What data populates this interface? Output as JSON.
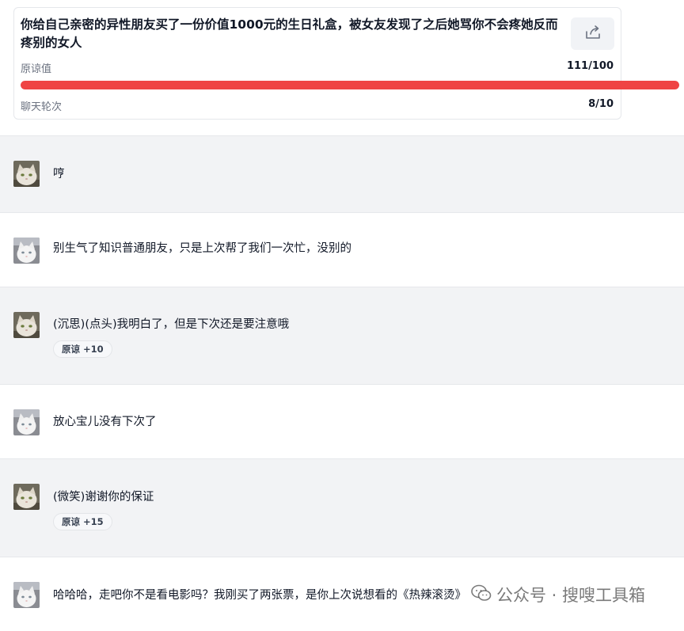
{
  "scenario": {
    "title": "你给自己亲密的异性朋友买了一份价值1000元的生日礼盒，被女友发现了之后她骂你不会疼她反而疼别的女人",
    "share_icon": "share-icon"
  },
  "forgiveness": {
    "label": "原谅值",
    "display": "111/100",
    "fraction": 1.0,
    "bar_color": "#ef4444"
  },
  "rounds": {
    "label": "聊天轮次",
    "display": "8/10"
  },
  "messages": [
    {
      "role": "girlfriend",
      "text": "哼",
      "avatar_icon": "cat-avatar-icon"
    },
    {
      "role": "user",
      "text": "别生气了知识普通朋友，只是上次帮了我们一次忙，没别的",
      "avatar_icon": "white-cat-avatar-icon"
    },
    {
      "role": "girlfriend",
      "text": "(沉思)(点头)我明白了，但是下次还是要注意哦",
      "badge": {
        "label": "原谅",
        "delta": "+10"
      }
    },
    {
      "role": "user",
      "text": "放心宝儿没有下次了"
    },
    {
      "role": "girlfriend",
      "text": "(微笑)谢谢你的保证",
      "badge": {
        "label": "原谅",
        "delta": "+15"
      }
    },
    {
      "role": "user",
      "text": "哈哈哈，走吧你不是看电影吗？我刚买了两张票，是你上次说想看的《热辣滚烫》"
    }
  ],
  "watermark": {
    "text": "公众号 · 搜嗖工具箱",
    "icon": "wechat-icon"
  }
}
